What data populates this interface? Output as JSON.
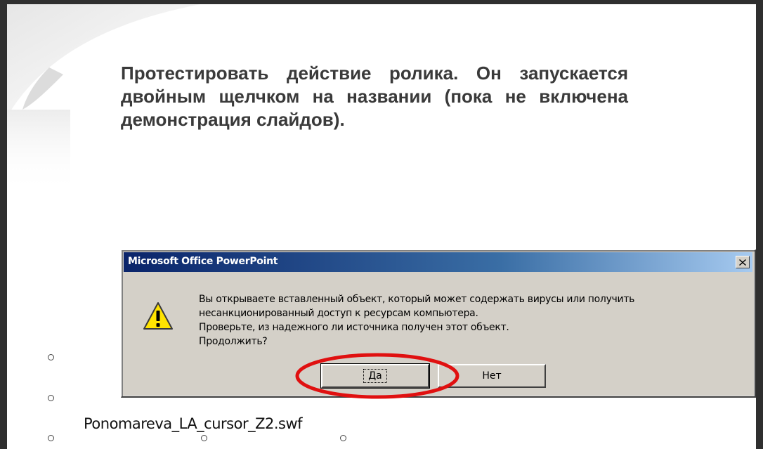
{
  "slide": {
    "instruction": "Протестировать действие ролика. Он запускается двойным щелчком на названии (пока не включена демонстрация слайдов).",
    "object_filename": "Ponomareva_LA_cursor_Z2.swf"
  },
  "dialog": {
    "title": "Microsoft Office PowerPoint",
    "close_label": "×",
    "icon": "warning-icon",
    "message_lines": [
      "Вы открываете вставленный объект, который может содержать вирусы или получить",
      "несанкционированный доступ к ресурсам компьютера.",
      "Проверьте, из надежного ли источника получен этот объект.",
      "Продолжить?"
    ],
    "yes_label": "Да",
    "no_label": "Нет"
  },
  "colors": {
    "highlight": "#e01010",
    "titlebar_start": "#0a246a",
    "titlebar_end": "#a6caf0",
    "dialog_face": "#d4d0c8"
  }
}
